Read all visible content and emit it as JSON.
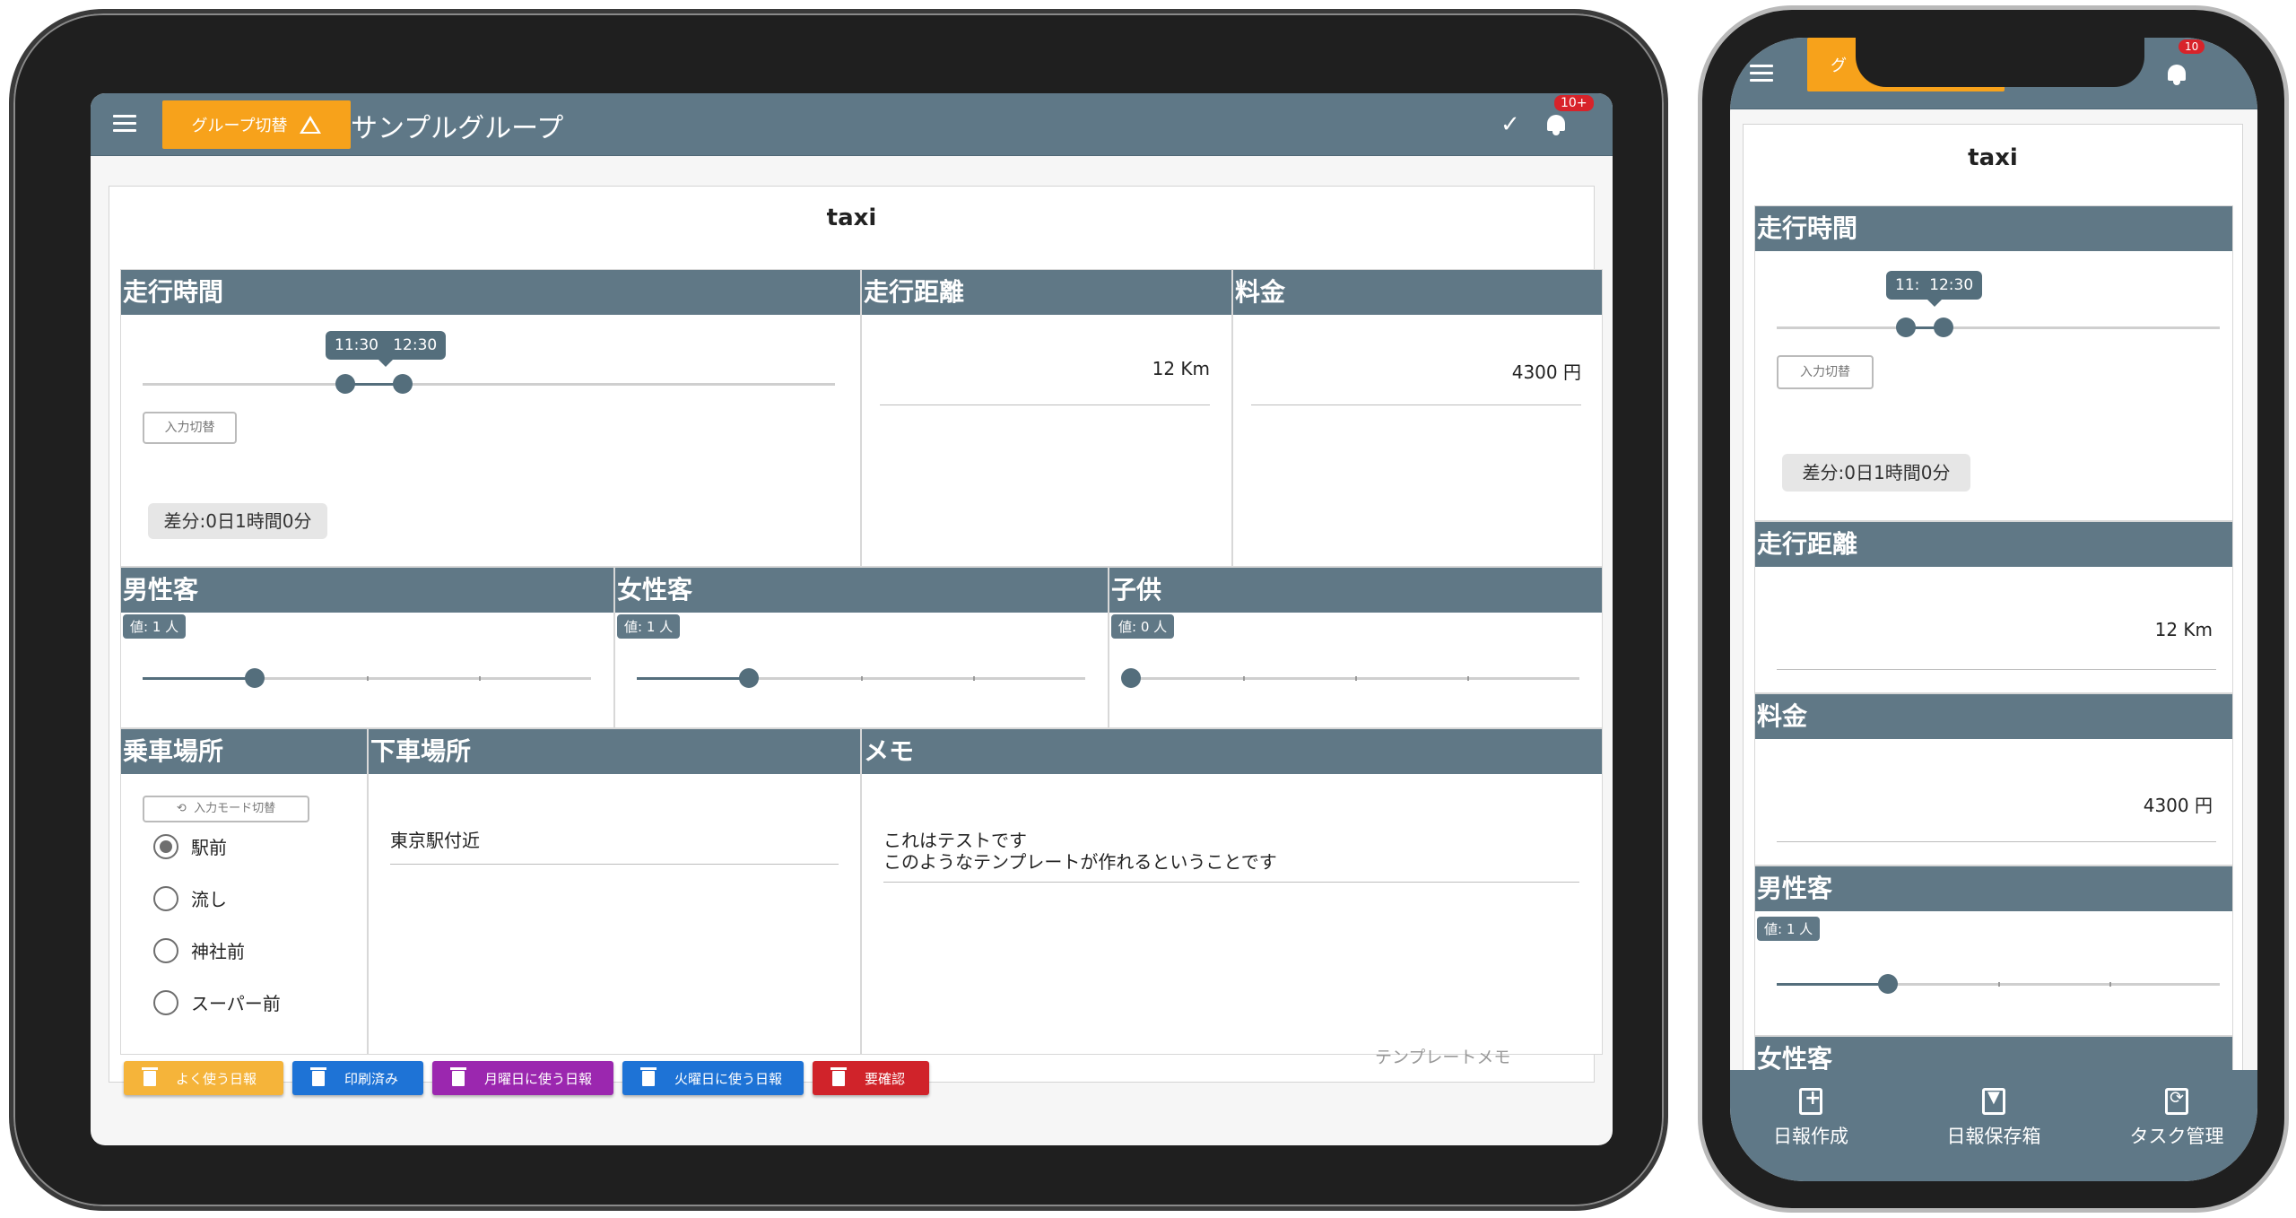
{
  "app": {
    "group_button": "グループ切替",
    "group_name": "サンプルグループ",
    "badge": "10+",
    "badge_phone": "10"
  },
  "record": {
    "title": "taxi"
  },
  "fields": {
    "time": {
      "label": "走行時間",
      "start": "11:30",
      "end": "12:30",
      "start_phone": "11:",
      "toggle": "入力切替",
      "diff": "差分:0日1時間0分",
      "range_fraction": [
        0.292,
        0.375
      ]
    },
    "distance": {
      "label": "走行距離",
      "value": "12 Km"
    },
    "fare": {
      "label": "料金",
      "value": "4300 円"
    },
    "male": {
      "label": "男性客",
      "value_label": "値: 1 人",
      "value": 1,
      "max": 4
    },
    "female": {
      "label": "女性客",
      "value_label": "値: 1 人",
      "value": 1,
      "max": 4
    },
    "child": {
      "label": "子供",
      "value_label": "値: 0 人",
      "value": 0,
      "max": 4
    },
    "pickup": {
      "label": "乗車場所",
      "mode_toggle": "入力モード切替",
      "options": [
        "駅前",
        "流し",
        "神社前",
        "スーパー前"
      ],
      "selected": "駅前"
    },
    "dropoff": {
      "label": "下車場所",
      "value": "東京駅付近"
    },
    "memo": {
      "label": "メモ",
      "line1": "これはテストです",
      "line2": "このようなテンプレートが作れるということです"
    }
  },
  "tags": [
    {
      "label": "よく使う日報",
      "color": "#f5b43a"
    },
    {
      "label": "印刷済み",
      "color": "#1e73d6"
    },
    {
      "label": "月曜日に使う日報",
      "color": "#9b27af"
    },
    {
      "label": "火曜日に使う日報",
      "color": "#1e73d6"
    },
    {
      "label": "要確認",
      "color": "#d0232a"
    }
  ],
  "footer": {
    "template_memo": "テンプレートメモ"
  },
  "bottom_nav": [
    {
      "label": "日報作成",
      "icon": "add-document-icon"
    },
    {
      "label": "日報保存箱",
      "icon": "archive-box-icon"
    },
    {
      "label": "タスク管理",
      "icon": "refresh-task-icon"
    }
  ]
}
